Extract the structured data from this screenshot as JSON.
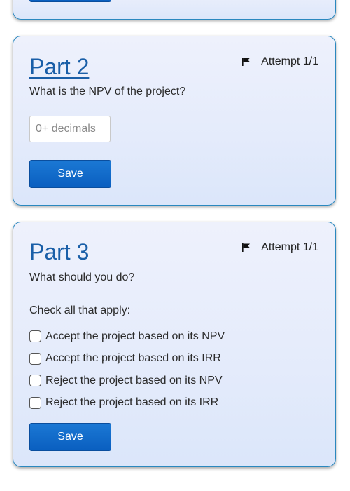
{
  "top_card": {
    "save_label": ""
  },
  "part2": {
    "title": "Part 2",
    "attempt": "Attempt 1/1",
    "question": "What is the NPV of the project?",
    "input_placeholder": "0+ decimals",
    "input_value": "",
    "save_label": "Save"
  },
  "part3": {
    "title": "Part 3",
    "attempt": "Attempt 1/1",
    "question": "What should you do?",
    "instruction": "Check all that apply:",
    "options": [
      {
        "label": "Accept the project based on its NPV",
        "checked": false
      },
      {
        "label": "Accept the project based on its IRR",
        "checked": false
      },
      {
        "label": "Reject the project based on its NPV",
        "checked": false
      },
      {
        "label": "Reject the project based on its IRR",
        "checked": false
      }
    ],
    "save_label": "Save"
  },
  "icons": {
    "flag": "flag-icon"
  },
  "colors": {
    "title_blue": "#1a5fa8",
    "button_blue": "#0a5fc0",
    "card_border": "#2a88bf"
  }
}
